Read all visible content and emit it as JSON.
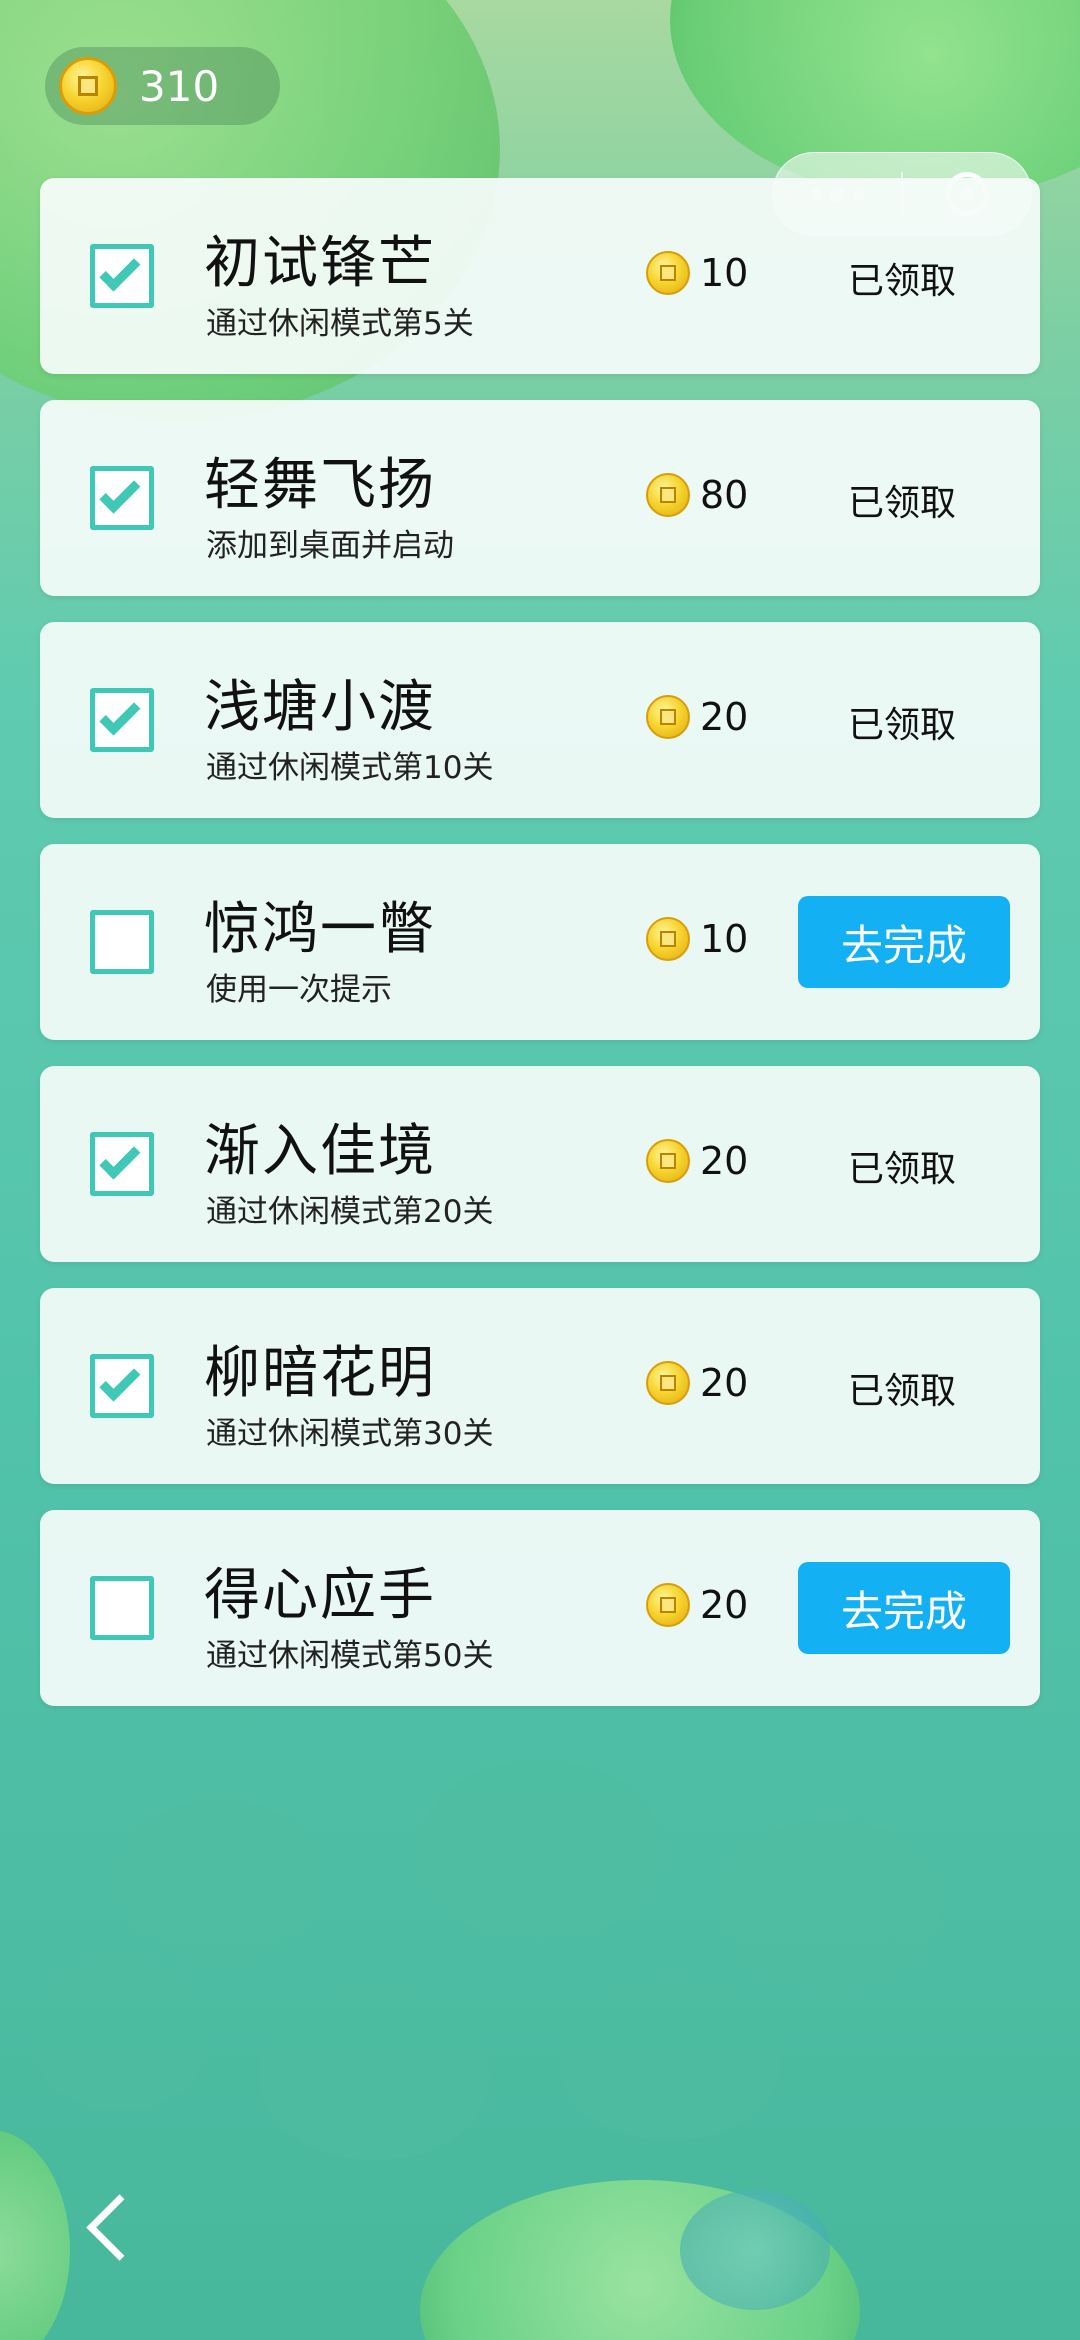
{
  "coins": {
    "icon": "coin-icon",
    "total": "310"
  },
  "capsule": {
    "more_icon": "more-dots-icon",
    "close_icon": "target-close-icon"
  },
  "tasks": [
    {
      "title": "初试锋芒",
      "desc": "通过休闲模式第5关",
      "reward": "10",
      "done": true,
      "action": "已领取"
    },
    {
      "title": "轻舞飞扬",
      "desc": "添加到桌面并启动",
      "reward": "80",
      "done": true,
      "action": "已领取"
    },
    {
      "title": "浅塘小渡",
      "desc": "通过休闲模式第10关",
      "reward": "20",
      "done": true,
      "action": "已领取"
    },
    {
      "title": "惊鸿一瞥",
      "desc": "使用一次提示",
      "reward": "10",
      "done": false,
      "action": "去完成"
    },
    {
      "title": "渐入佳境",
      "desc": "通过休闲模式第20关",
      "reward": "20",
      "done": true,
      "action": "已领取"
    },
    {
      "title": "柳暗花明",
      "desc": "通过休闲模式第30关",
      "reward": "20",
      "done": true,
      "action": "已领取"
    },
    {
      "title": "得心应手",
      "desc": "通过休闲模式第50关",
      "reward": "20",
      "done": false,
      "action": "去完成"
    }
  ],
  "back": {
    "icon": "back-arrow-icon"
  },
  "colors": {
    "accent": "#13b0f3",
    "check": "#3fc8b5"
  }
}
